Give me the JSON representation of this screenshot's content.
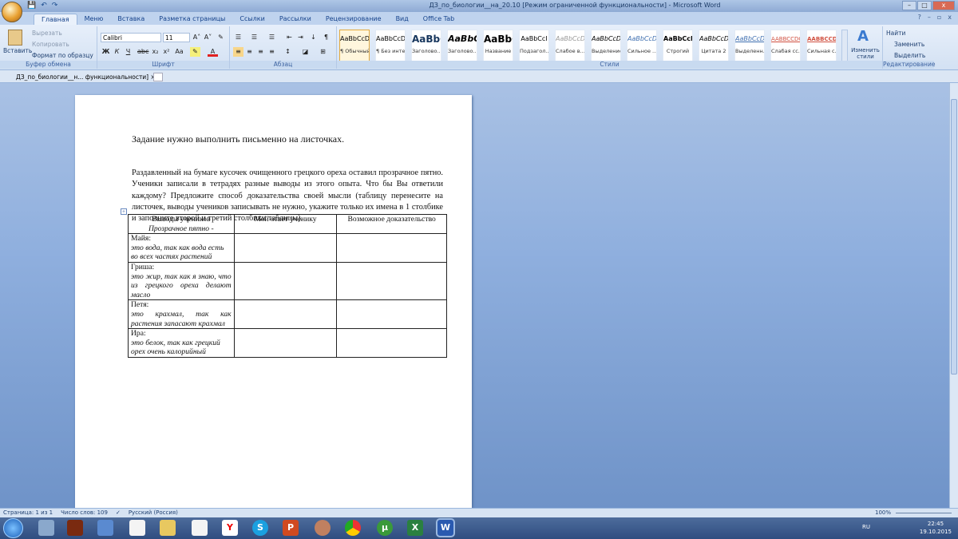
{
  "window": {
    "title": "ДЗ_по_биологии__на_20.10 [Режим ограниченной функциональности] - Microsoft Word",
    "minimize": "–",
    "maximize": "□",
    "close": "x"
  },
  "ribbon_tabs": [
    "Главная",
    "Меню",
    "Вставка",
    "Разметка страницы",
    "Ссылки",
    "Рассылки",
    "Рецензирование",
    "Вид",
    "Office Tab"
  ],
  "clipboard": {
    "paste": "Вставить",
    "cut": "Вырезать",
    "copy": "Копировать",
    "format_painter": "Формат по образцу",
    "group": "Буфер обмена"
  },
  "font": {
    "name": "Calibri",
    "size": "11",
    "group": "Шрифт",
    "bold": "Ж",
    "italic": "К",
    "underline": "Ч",
    "strike": "abc",
    "sub": "x₂",
    "sup": "x²",
    "case": "Aa",
    "grow": "A˄",
    "shrink": "A˅"
  },
  "paragraph": {
    "group": "Абзац"
  },
  "styles": {
    "group": "Стили",
    "items": [
      {
        "preview": "AaBbCcDc",
        "name": "¶ Обычный"
      },
      {
        "preview": "AaBbCcDc",
        "name": "¶ Без инте..."
      },
      {
        "preview": "AaBbC",
        "name": "Заголово..."
      },
      {
        "preview": "AaBbC",
        "name": "Заголово..."
      },
      {
        "preview": "AaBbC",
        "name": "Название"
      },
      {
        "preview": "AaBbCcI",
        "name": "Подзагол..."
      },
      {
        "preview": "AaBbCcDc",
        "name": "Слабое в..."
      },
      {
        "preview": "AaBbCcDc",
        "name": "Выделение"
      },
      {
        "preview": "AaBbCcDc",
        "name": "Сильное ..."
      },
      {
        "preview": "AaBbCcDc",
        "name": "Строгий"
      },
      {
        "preview": "AaBbCcDc",
        "name": "Цитата 2"
      },
      {
        "preview": "AaBbCcDc",
        "name": "Выделенн..."
      },
      {
        "preview": "AABBCCDC",
        "name": "Слабая сс..."
      },
      {
        "preview": "AABBCCDC",
        "name": "Сильная с..."
      }
    ],
    "change": "Изменить стили"
  },
  "editing": {
    "group": "Редактирование",
    "find": "Найти",
    "replace": "Заменить",
    "select": "Выделить"
  },
  "doc_tab": {
    "label": "ДЗ_по_биологии__н... функциональности]",
    "close": "×"
  },
  "document": {
    "heading": "Задание нужно выполнить письменно на листочках.",
    "paragraph": "Раздавленный на бумаге кусочек очищенного грецкого ореха оставил прозрачное пятно. Ученики записали в тетрадях разные выводы из этого опыта. Что бы Вы ответили каждому? Предложите способ доказательства своей мысли (таблицу перенесите на листочек, выводы учеников записывать не нужно, укажите только их имена в 1 столбике и заполните второй и третий столбики таблицы).",
    "table": {
      "headers": [
        "Выводы учеников",
        "Мой ответ ученику",
        "Возможное доказательство"
      ],
      "header_sub": "Прозрачное пятно -",
      "rows": [
        {
          "name": "Майя:",
          "text": "это вода, так как вода есть во всех частях растений"
        },
        {
          "name": "Гриша:",
          "text": "это жир, так как я знаю, что из грецкого ореха делают масло"
        },
        {
          "name": "Петя:",
          "text": "это крахмал, так как растения запасают крахмал"
        },
        {
          "name": "Ира:",
          "text": "это белок, так как грецкий орех очень калорийный"
        }
      ]
    }
  },
  "status": {
    "page": "Страница: 1 из 1",
    "words": "Число слов: 109",
    "language": "Русский (Россия)",
    "zoom": "100%"
  },
  "taskbar": {
    "lang": "RU",
    "time": "22:45",
    "date": "19.10.2015"
  }
}
